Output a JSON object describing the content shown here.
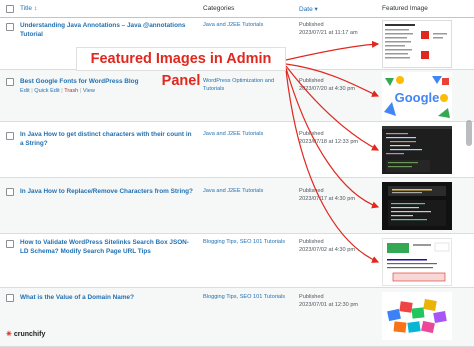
{
  "header": {
    "title_col": "Title",
    "categories_col": "Categories",
    "date_col": "Date",
    "featured_col": "Featured Image"
  },
  "overlay": {
    "title": "Featured Images in Admin Panel"
  },
  "rows": [
    {
      "title": "Understanding Java Annotations – Java @annotations Tutorial",
      "categories": "Java and J2EE Tutorials",
      "date_status": "Published",
      "date": "2023/07/21 at 11:17 am"
    },
    {
      "title": "Best Google Fonts for WordPress Blog",
      "actions": {
        "edit": "Edit",
        "quick_edit": "Quick Edit",
        "trash": "Trash",
        "view": "View"
      },
      "categories": "WordPress Optimization and Tutorials",
      "date_status": "Published",
      "date": "2023/07/20 at 4:30 pm"
    },
    {
      "title": "In Java How to get distinct characters with their count in a String?",
      "categories": "Java and J2EE Tutorials",
      "date_status": "Published",
      "date": "2023/07/18 at 12:33 pm"
    },
    {
      "title": "In Java How to Replace/Remove Characters from String?",
      "categories": "Java and J2EE Tutorials",
      "date_status": "Published",
      "date": "2023/07/17 at 4:30 pm"
    },
    {
      "title": "How to Validate WordPress Sitelinks Search Box JSON-LD Schema? Modify Search Page URL Tips",
      "categories": "Blogging Tips, SEO 101 Tutorials",
      "date_status": "Published",
      "date": "2023/07/02 at 4:30 pm"
    },
    {
      "title": "What is the Value of a Domain Name?",
      "categories": "Blogging Tips, SEO 101 Tutorials",
      "date_status": "Published",
      "date": "2023/07/01 at 12:30 pm"
    }
  ],
  "thumb2": {
    "google_word": "Google"
  },
  "logo": {
    "text": "crunchify"
  },
  "colors": {
    "link": "#2271b1",
    "arrow": "#e0281f",
    "trash": "#b32d2e"
  }
}
